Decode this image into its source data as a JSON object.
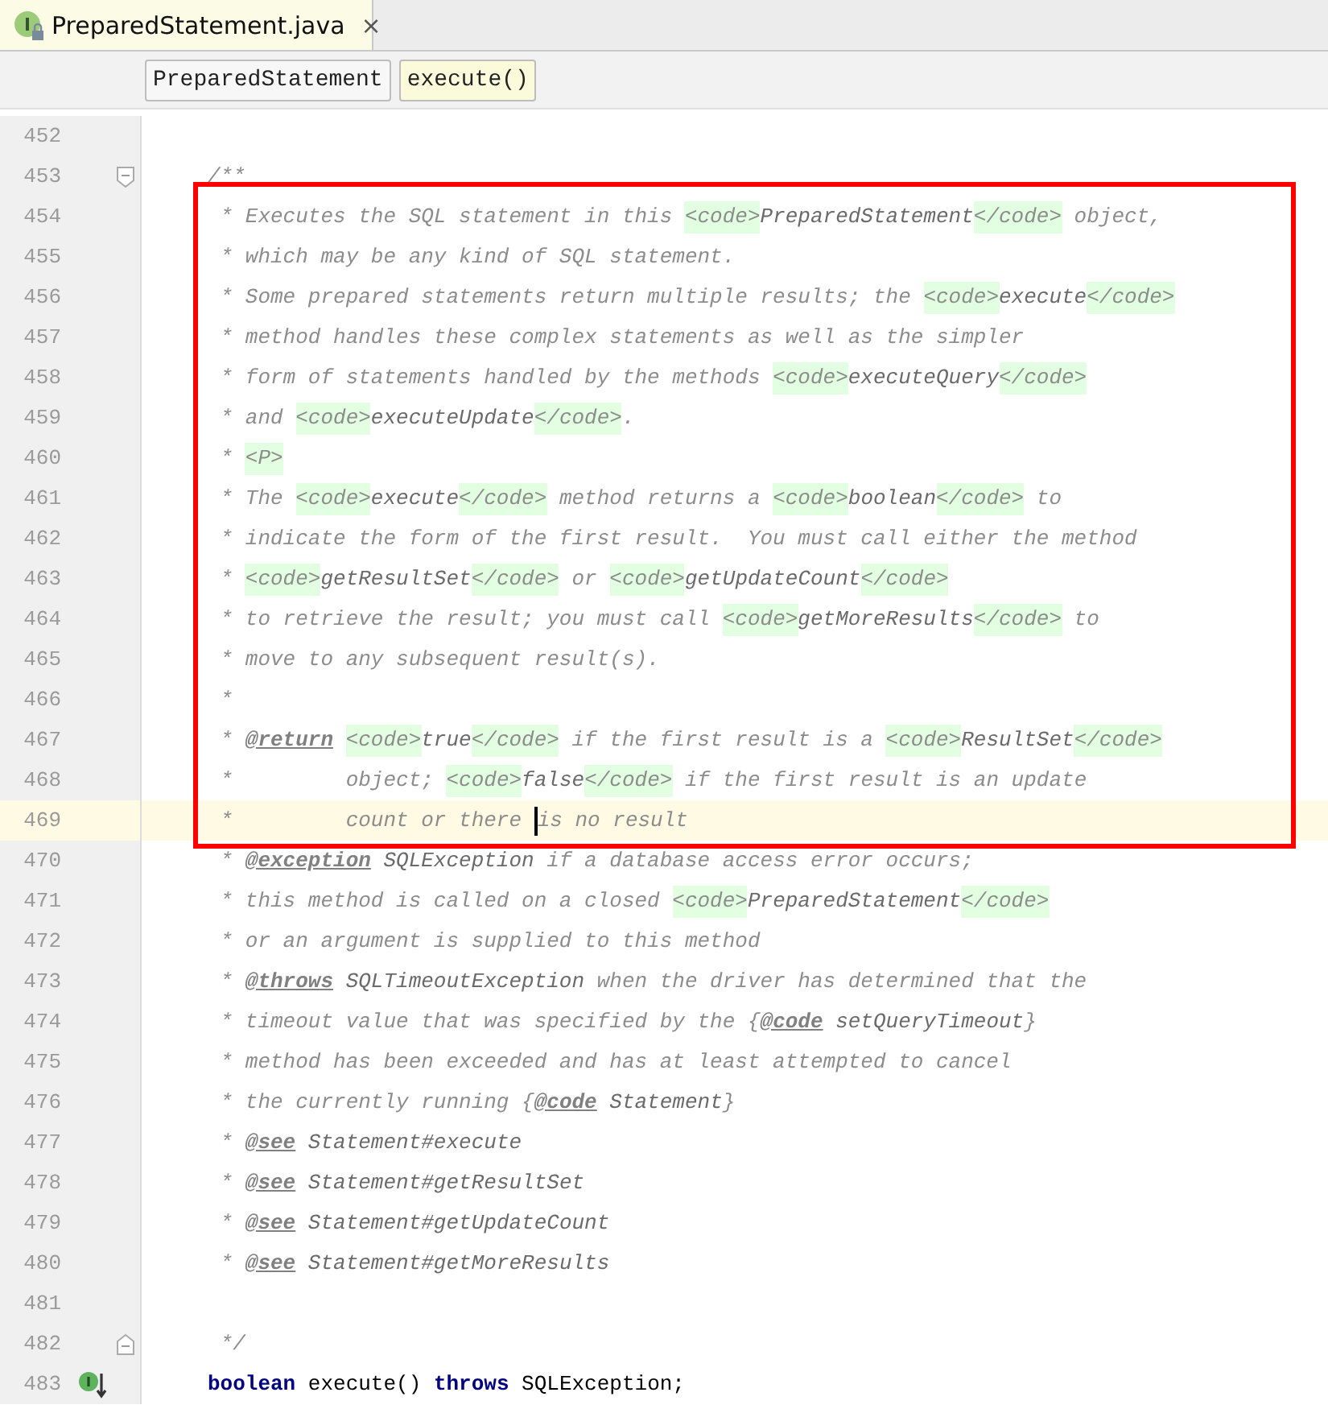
{
  "tab": {
    "label": "PreparedStatement.java",
    "close": "×",
    "selected": true
  },
  "breadcrumbs": [
    {
      "label": "PreparedStatement",
      "selected": false
    },
    {
      "label": "execute()",
      "selected": true
    }
  ],
  "lines": [
    {
      "number": "452",
      "current": false
    },
    {
      "number": "453",
      "current": false,
      "fold_start": true,
      "segments": [
        {
          "kind": "comment",
          "text": "/**"
        }
      ]
    },
    {
      "number": "454",
      "current": false,
      "segments": [
        {
          "kind": "comment",
          "text": " * Executes the SQL statement in this "
        },
        {
          "kind": "tag",
          "text": "<code>"
        },
        {
          "kind": "value",
          "text": "PreparedStatement"
        },
        {
          "kind": "tag",
          "text": "</code>"
        },
        {
          "kind": "comment",
          "text": " object,"
        }
      ]
    },
    {
      "number": "455",
      "current": false,
      "segments": [
        {
          "kind": "comment",
          "text": " * which may be any kind of SQL statement."
        }
      ]
    },
    {
      "number": "456",
      "current": false,
      "segments": [
        {
          "kind": "comment",
          "text": " * Some prepared statements return multiple results; the "
        },
        {
          "kind": "tag",
          "text": "<code>"
        },
        {
          "kind": "value",
          "text": "execute"
        },
        {
          "kind": "tag",
          "text": "</code>"
        }
      ]
    },
    {
      "number": "457",
      "current": false,
      "segments": [
        {
          "kind": "comment",
          "text": " * method handles these complex statements as well as the simpler"
        }
      ]
    },
    {
      "number": "458",
      "current": false,
      "segments": [
        {
          "kind": "comment",
          "text": " * form of statements handled by the methods "
        },
        {
          "kind": "tag",
          "text": "<code>"
        },
        {
          "kind": "value",
          "text": "executeQuery"
        },
        {
          "kind": "tag",
          "text": "</code>"
        }
      ]
    },
    {
      "number": "459",
      "current": false,
      "segments": [
        {
          "kind": "comment",
          "text": " * and "
        },
        {
          "kind": "tag",
          "text": "<code>"
        },
        {
          "kind": "value",
          "text": "executeUpdate"
        },
        {
          "kind": "tag",
          "text": "</code>"
        },
        {
          "kind": "comment",
          "text": "."
        }
      ]
    },
    {
      "number": "460",
      "current": false,
      "segments": [
        {
          "kind": "comment",
          "text": " * "
        },
        {
          "kind": "tag",
          "text": "<P>"
        }
      ]
    },
    {
      "number": "461",
      "current": false,
      "segments": [
        {
          "kind": "comment",
          "text": " * The "
        },
        {
          "kind": "tag",
          "text": "<code>"
        },
        {
          "kind": "value",
          "text": "execute"
        },
        {
          "kind": "tag",
          "text": "</code>"
        },
        {
          "kind": "comment",
          "text": " method returns a "
        },
        {
          "kind": "tag",
          "text": "<code>"
        },
        {
          "kind": "value",
          "text": "boolean"
        },
        {
          "kind": "tag",
          "text": "</code>"
        },
        {
          "kind": "comment",
          "text": " to"
        }
      ]
    },
    {
      "number": "462",
      "current": false,
      "segments": [
        {
          "kind": "comment",
          "text": " * indicate the form of the first result.  You must call either the method"
        }
      ]
    },
    {
      "number": "463",
      "current": false,
      "segments": [
        {
          "kind": "comment",
          "text": " * "
        },
        {
          "kind": "tag",
          "text": "<code>"
        },
        {
          "kind": "value",
          "text": "getResultSet"
        },
        {
          "kind": "tag",
          "text": "</code>"
        },
        {
          "kind": "comment",
          "text": " or "
        },
        {
          "kind": "tag",
          "text": "<code>"
        },
        {
          "kind": "value",
          "text": "getUpdateCount"
        },
        {
          "kind": "tag",
          "text": "</code>"
        }
      ]
    },
    {
      "number": "464",
      "current": false,
      "segments": [
        {
          "kind": "comment",
          "text": " * to retrieve the result; you must call "
        },
        {
          "kind": "tag",
          "text": "<code>"
        },
        {
          "kind": "value",
          "text": "getMoreResults"
        },
        {
          "kind": "tag",
          "text": "</code>"
        },
        {
          "kind": "comment",
          "text": " to"
        }
      ]
    },
    {
      "number": "465",
      "current": false,
      "segments": [
        {
          "kind": "comment",
          "text": " * move to any subsequent result(s)."
        }
      ]
    },
    {
      "number": "466",
      "current": false,
      "segments": [
        {
          "kind": "comment",
          "text": " *"
        }
      ]
    },
    {
      "number": "467",
      "current": false,
      "segments": [
        {
          "kind": "comment",
          "text": " * "
        },
        {
          "kind": "doctag",
          "text": "@return"
        },
        {
          "kind": "tag",
          "text": "<code>"
        },
        {
          "kind": "value",
          "text": "true"
        },
        {
          "kind": "tag",
          "text": "</code>"
        },
        {
          "kind": "comment",
          "text": " if the first result is a "
        },
        {
          "kind": "tag",
          "text": "<code>"
        },
        {
          "kind": "value",
          "text": "ResultSet"
        },
        {
          "kind": "tag",
          "text": "</code>"
        }
      ]
    },
    {
      "number": "468",
      "current": false,
      "segments": [
        {
          "kind": "comment",
          "text": " *         object; "
        },
        {
          "kind": "tag",
          "text": "<code>"
        },
        {
          "kind": "value",
          "text": "false"
        },
        {
          "kind": "tag",
          "text": "</code>"
        },
        {
          "kind": "comment",
          "text": " if the first result is an update"
        }
      ]
    },
    {
      "number": "469",
      "current": true,
      "segments": [
        {
          "kind": "comment",
          "text": " *         count or there "
        },
        {
          "kind": "comment",
          "text": "is no result",
          "caret_before": true
        }
      ]
    },
    {
      "number": "470",
      "current": false,
      "segments": [
        {
          "kind": "comment",
          "text": " * "
        },
        {
          "kind": "doctag",
          "text": "@exception"
        },
        {
          "kind": "value",
          "text": "SQLException"
        },
        {
          "kind": "comment",
          "text": " if a database access error occurs;"
        }
      ]
    },
    {
      "number": "471",
      "current": false,
      "segments": [
        {
          "kind": "comment",
          "text": " * this method is called on a closed "
        },
        {
          "kind": "tag",
          "text": "<code>"
        },
        {
          "kind": "value",
          "text": "PreparedStatement"
        },
        {
          "kind": "tag",
          "text": "</code>"
        }
      ]
    },
    {
      "number": "472",
      "current": false,
      "segments": [
        {
          "kind": "comment",
          "text": " * or an argument is supplied to this method"
        }
      ]
    },
    {
      "number": "473",
      "current": false,
      "segments": [
        {
          "kind": "comment",
          "text": " * "
        },
        {
          "kind": "doctag",
          "text": "@throws"
        },
        {
          "kind": "value",
          "text": "SQLTimeoutException"
        },
        {
          "kind": "comment",
          "text": " when the driver has determined that the"
        }
      ]
    },
    {
      "number": "474",
      "current": false,
      "segments": [
        {
          "kind": "comment",
          "text": " * timeout value that was specified by the {"
        },
        {
          "kind": "doctag",
          "text": "@code"
        },
        {
          "kind": "value",
          "text": "setQueryTimeout"
        },
        {
          "kind": "comment",
          "text": "}"
        }
      ]
    },
    {
      "number": "475",
      "current": false,
      "segments": [
        {
          "kind": "comment",
          "text": " * method has been exceeded and has at least attempted to cancel"
        }
      ]
    },
    {
      "number": "476",
      "current": false,
      "segments": [
        {
          "kind": "comment",
          "text": " * the currently running {"
        },
        {
          "kind": "doctag",
          "text": "@code"
        },
        {
          "kind": "value",
          "text": "Statement"
        },
        {
          "kind": "comment",
          "text": "}"
        }
      ]
    },
    {
      "number": "477",
      "current": false,
      "segments": [
        {
          "kind": "comment",
          "text": " * "
        },
        {
          "kind": "doctag",
          "text": "@see"
        },
        {
          "kind": "value",
          "text": "Statement#execute"
        }
      ]
    },
    {
      "number": "478",
      "current": false,
      "segments": [
        {
          "kind": "comment",
          "text": " * "
        },
        {
          "kind": "doctag",
          "text": "@see"
        },
        {
          "kind": "value",
          "text": "Statement#getResultSet"
        }
      ]
    },
    {
      "number": "479",
      "current": false,
      "segments": [
        {
          "kind": "comment",
          "text": " * "
        },
        {
          "kind": "doctag",
          "text": "@see"
        },
        {
          "kind": "value",
          "text": "Statement#getUpdateCount"
        }
      ]
    },
    {
      "number": "480",
      "current": false,
      "segments": [
        {
          "kind": "comment",
          "text": " * "
        },
        {
          "kind": "doctag",
          "text": "@see"
        },
        {
          "kind": "value",
          "text": "Statement#getMoreResults"
        }
      ]
    },
    {
      "number": "481",
      "current": false
    },
    {
      "number": "482",
      "current": false,
      "fold_end": true,
      "segments": [
        {
          "kind": "comment",
          "text": " */"
        }
      ]
    },
    {
      "number": "483",
      "current": false,
      "implemented": true,
      "segments": [
        {
          "kind": "keyword",
          "text": "boolean"
        },
        {
          "kind": "plain",
          "text": " execute() "
        },
        {
          "kind": "keyword",
          "text": "throws"
        },
        {
          "kind": "plain",
          "text": " SQLException;"
        }
      ]
    }
  ]
}
